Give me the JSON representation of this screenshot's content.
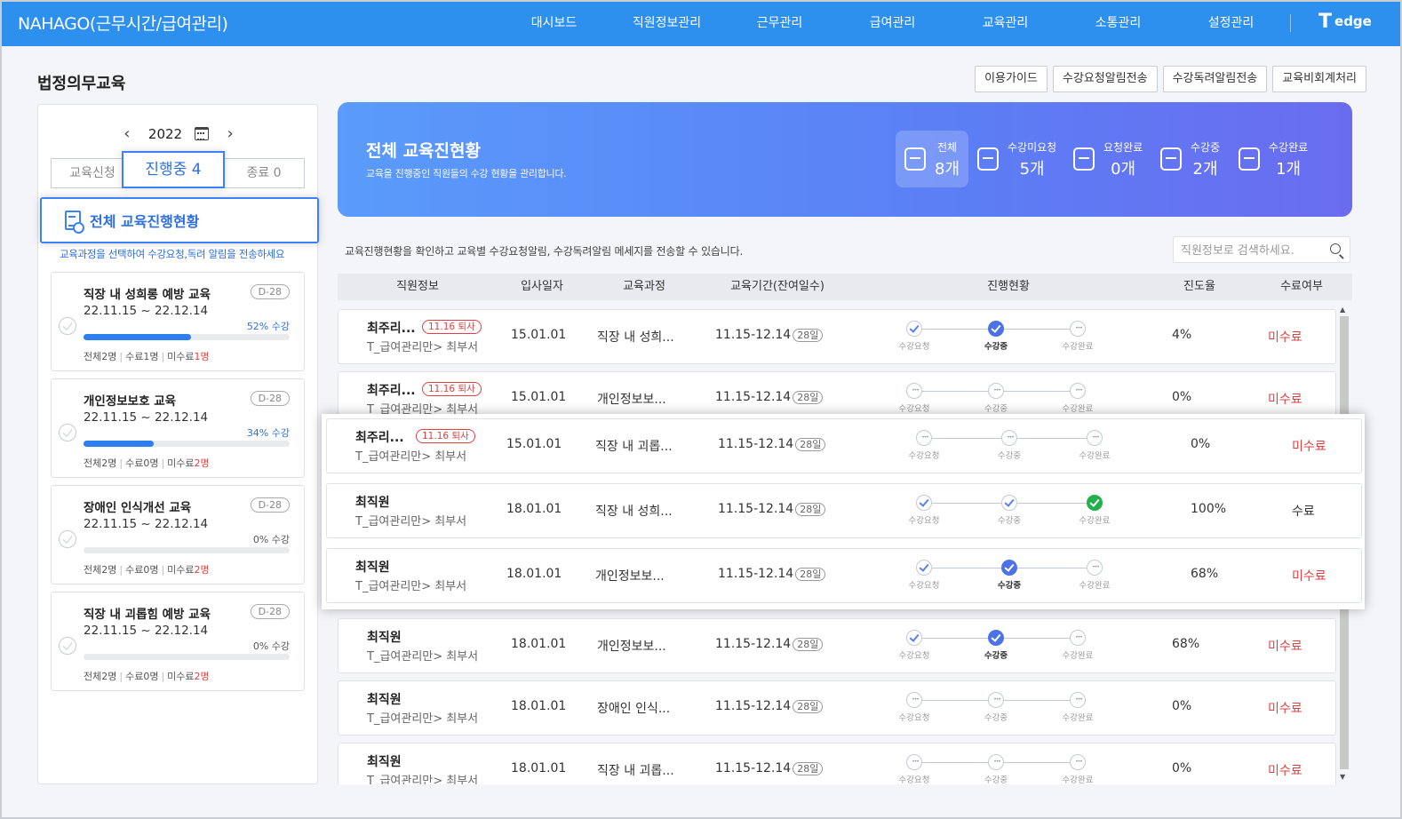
{
  "header": {
    "brand": "NAHAGO(근무시간/급여관리)",
    "nav": [
      "대시보드",
      "직원정보관리",
      "근무관리",
      "급여관리",
      "교육관리",
      "소통관리",
      "설정관리"
    ],
    "logo_mark": "T",
    "logo_word": "edge"
  },
  "page_title": "법정의무교육",
  "actions": [
    "이용가이드",
    "수강요청알림전송",
    "수강독려알림전송",
    "교육비회계처리"
  ],
  "left": {
    "year": "2022",
    "prev": "‹",
    "next": "›",
    "tabs": [
      {
        "label": "교육신청"
      },
      {
        "label": "진행중 4"
      },
      {
        "label": "종료 0"
      }
    ],
    "overall_label": "전체 교육진행현황",
    "hint": "교육과정을 선택하여 수강요청,독려 알림을 전송하세요",
    "courses": [
      {
        "name": "직장 내 성희롱 예방 교육",
        "dday": "D-28",
        "period": "22.11.15 ~ 22.12.14",
        "pct_text": "52% 수강",
        "pct": 52,
        "total": "전체2명",
        "done": "수료1명",
        "undone_label": "미수료",
        "undone_num": "1명"
      },
      {
        "name": "개인정보보호 교육",
        "dday": "D-28",
        "period": "22.11.15 ~ 22.12.14",
        "pct_text": "34% 수강",
        "pct": 34,
        "total": "전체2명",
        "done": "수료0명",
        "undone_label": "미수료",
        "undone_num": "2명"
      },
      {
        "name": "장애인 인식개선 교육",
        "dday": "D-28",
        "period": "22.11.15 ~ 22.12.14",
        "pct_text": "0% 수강",
        "pct": 0,
        "total": "전체2명",
        "done": "수료0명",
        "undone_label": "미수료",
        "undone_num": "2명"
      },
      {
        "name": "직장 내 괴롭힘 예방 교육",
        "dday": "D-28",
        "period": "22.11.15 ~ 22.12.14",
        "pct_text": "0% 수강",
        "pct": 0,
        "total": "전체2명",
        "done": "수료0명",
        "undone_label": "미수료",
        "undone_num": "2명"
      }
    ]
  },
  "banner": {
    "title": "전체 교육진현황",
    "subtitle": "교육을 진행중인 직원들의 수강 현황을 관리합니다.",
    "stats": [
      {
        "label": "전체",
        "value": "8개"
      },
      {
        "label": "수강미요청",
        "value": "5개"
      },
      {
        "label": "요청완료",
        "value": "0개"
      },
      {
        "label": "수강중",
        "value": "2개"
      },
      {
        "label": "수강완료",
        "value": "1개"
      }
    ]
  },
  "info_text": "교육진행현황을 확인하고 교육별 수강요청알림, 수강독려알림 메세지를 전송할 수 있습니다.",
  "search_placeholder": "직원정보로 검색하세요.",
  "table": {
    "headers": [
      "직원정보",
      "입사일자",
      "교육과정",
      "교육기간(잔여일수)",
      "진행현황",
      "진도율",
      "수료여부"
    ],
    "step_labels": [
      "수강요청",
      "수강중",
      "수강완료"
    ],
    "rows": [
      {
        "name": "최주리...",
        "tag": "11.16 퇴사",
        "dept": "T_급여관리만> 최부서",
        "join": "15.01.01",
        "course": "직장 내 성희...",
        "period": "11.15-12.14",
        "remain": "28일",
        "steps": [
          "done",
          "cur",
          "wait"
        ],
        "progress": "4%",
        "status": "미수료"
      },
      {
        "name": "최주리...",
        "tag": "11.16 퇴사",
        "dept": "T_급여관리만> 최부서",
        "join": "15.01.01",
        "course": "개인정보보...",
        "period": "11.15-12.14",
        "remain": "28일",
        "steps": [
          "wait",
          "wait",
          "wait"
        ],
        "progress": "0%",
        "status": "미수료"
      },
      {
        "name": "최주리...",
        "tag": "11.16 퇴사",
        "dept": "T_급여관리만> 최부서",
        "join": "15.01.01",
        "course": "직장 내 괴롭...",
        "period": "11.15-12.14",
        "remain": "28일",
        "steps": [
          "wait",
          "wait",
          "wait"
        ],
        "progress": "0%",
        "status": "미수료"
      },
      {
        "name": "최직원",
        "tag": "",
        "dept": "T_급여관리만> 최부서",
        "join": "18.01.01",
        "course": "직장 내 성희...",
        "period": "11.15-12.14",
        "remain": "28일",
        "steps": [
          "done",
          "done",
          "fin"
        ],
        "progress": "100%",
        "status": "수료"
      },
      {
        "name": "최직원",
        "tag": "",
        "dept": "T_급여관리만> 최부서",
        "join": "18.01.01",
        "course": "개인정보보...",
        "period": "11.15-12.14",
        "remain": "28일",
        "steps": [
          "done",
          "cur",
          "wait"
        ],
        "progress": "68%",
        "status": "미수료"
      },
      {
        "name": "최직원",
        "tag": "",
        "dept": "T_급여관리만> 최부서",
        "join": "18.01.01",
        "course": "개인정보보...",
        "period": "11.15-12.14",
        "remain": "28일",
        "steps": [
          "done",
          "cur",
          "wait"
        ],
        "progress": "68%",
        "status": "미수료"
      },
      {
        "name": "최직원",
        "tag": "",
        "dept": "T_급여관리만> 최부서",
        "join": "18.01.01",
        "course": "장애인 인식...",
        "period": "11.15-12.14",
        "remain": "28일",
        "steps": [
          "wait",
          "wait",
          "wait"
        ],
        "progress": "0%",
        "status": "미수료"
      },
      {
        "name": "최직원",
        "tag": "",
        "dept": "T_급여관리만> 최부서",
        "join": "18.01.01",
        "course": "직장 내 괴롭...",
        "period": "11.15-12.14",
        "remain": "28일",
        "steps": [
          "wait",
          "wait",
          "wait"
        ],
        "progress": "0%",
        "status": "미수료"
      }
    ]
  },
  "scroll": {
    "up": "▲",
    "down": "▼"
  }
}
